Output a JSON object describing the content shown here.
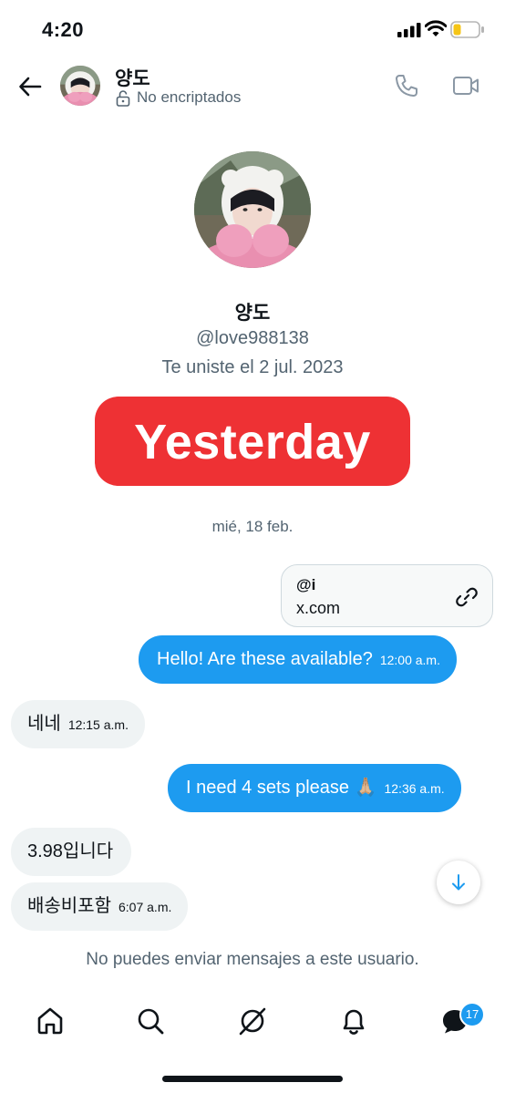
{
  "status_bar": {
    "time": "4:20"
  },
  "header": {
    "name": "양도",
    "encryption": "No encriptados",
    "icons": [
      "back-arrow-icon",
      "lock-icon",
      "phone-icon",
      "video-icon"
    ]
  },
  "profile": {
    "name": "양도",
    "handle": "@love988138",
    "joined": "Te uniste el 2 jul. 2023"
  },
  "banner": {
    "text": "Yesterday",
    "color": "#ee3134"
  },
  "date_separator": "mié, 18 feb.",
  "link_card": {
    "title": "@i",
    "domain": "x.com"
  },
  "messages": [
    {
      "direction": "out",
      "text": "Hello! Are these available?",
      "time": "12:00 a.m."
    },
    {
      "direction": "in",
      "text": "네네",
      "time": "12:15 a.m."
    },
    {
      "direction": "out",
      "text": "I need 4 sets please 🙏🏼",
      "time": "12:36 a.m."
    },
    {
      "direction": "in",
      "text": "3.98입니다",
      "time": ""
    },
    {
      "direction": "in",
      "text": "배송비포함",
      "time": "6:07 a.m."
    }
  ],
  "notice": "No puedes enviar mensajes a este usuario.",
  "nav": {
    "items": [
      "home-icon",
      "search-icon",
      "grok-icon",
      "notifications-icon",
      "messages-icon"
    ],
    "messages_badge": "17"
  },
  "colors": {
    "accent": "#1d9bf0",
    "incoming_bubble": "#eff3f4",
    "muted_text": "#536471"
  }
}
